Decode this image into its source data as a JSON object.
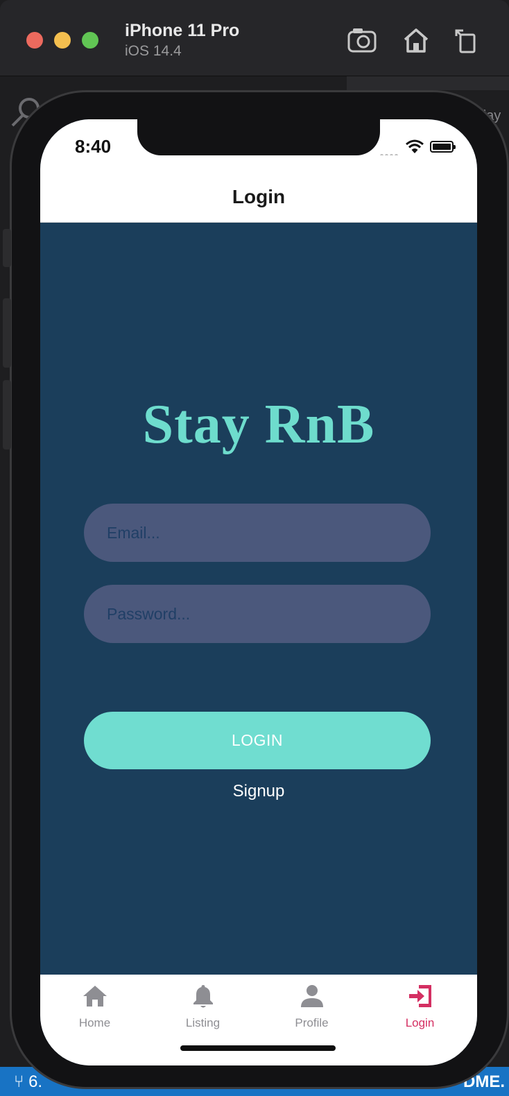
{
  "simulator": {
    "device_name": "iPhone 11 Pro",
    "os_version": "iOS 14.4",
    "toolbar_icons": [
      "screenshot-camera-icon",
      "home-icon",
      "rotate-icon"
    ]
  },
  "background": {
    "editor_snippet": "day",
    "status_left": "6.",
    "status_right": "DME."
  },
  "status_bar": {
    "time": "8:40"
  },
  "nav": {
    "title": "Login"
  },
  "brand": {
    "name": "Stay RnB",
    "color": "#6edccd"
  },
  "form": {
    "email_placeholder": "Email...",
    "email_value": "",
    "password_placeholder": "Password...",
    "password_value": "",
    "login_label": "LOGIN",
    "signup_label": "Signup"
  },
  "tabs": [
    {
      "label": "Home",
      "icon": "home-icon",
      "active": false
    },
    {
      "label": "Listing",
      "icon": "bell-icon",
      "active": false
    },
    {
      "label": "Profile",
      "icon": "person-icon",
      "active": false
    },
    {
      "label": "Login",
      "icon": "login-arrow-icon",
      "active": true
    }
  ],
  "colors": {
    "screen_background": "#1b3e5b",
    "input_background": "#4b587c",
    "button_background": "#70ddd0",
    "active_tab": "#d42f62",
    "inactive_tab": "#8e8e93"
  }
}
